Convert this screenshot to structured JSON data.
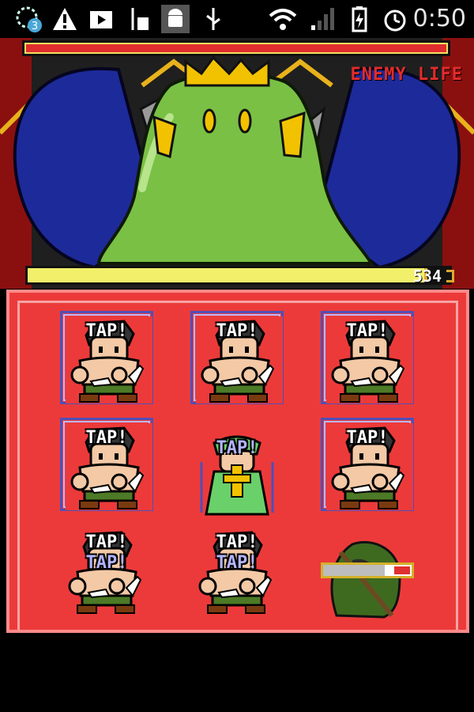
{
  "status_bar": {
    "notification_count": "3",
    "time": "0:50"
  },
  "battle": {
    "enemy_life_label": "ENEMY LIFE",
    "enemy_life_fraction": 1.0,
    "player_hp_value": "534",
    "player_hp_fraction": 0.94
  },
  "grid": {
    "tap_label": "TAP!",
    "timer_fraction": 0.7
  },
  "colors": {
    "enemy_bar": "#e12d2d",
    "player_bar": "#f2f06a",
    "board": "#ec3a3a",
    "tile_frame": "#4f4fb8",
    "enemy_body": "#7ac045",
    "crown": "#f2c200",
    "wings": "#1d2a9a"
  }
}
